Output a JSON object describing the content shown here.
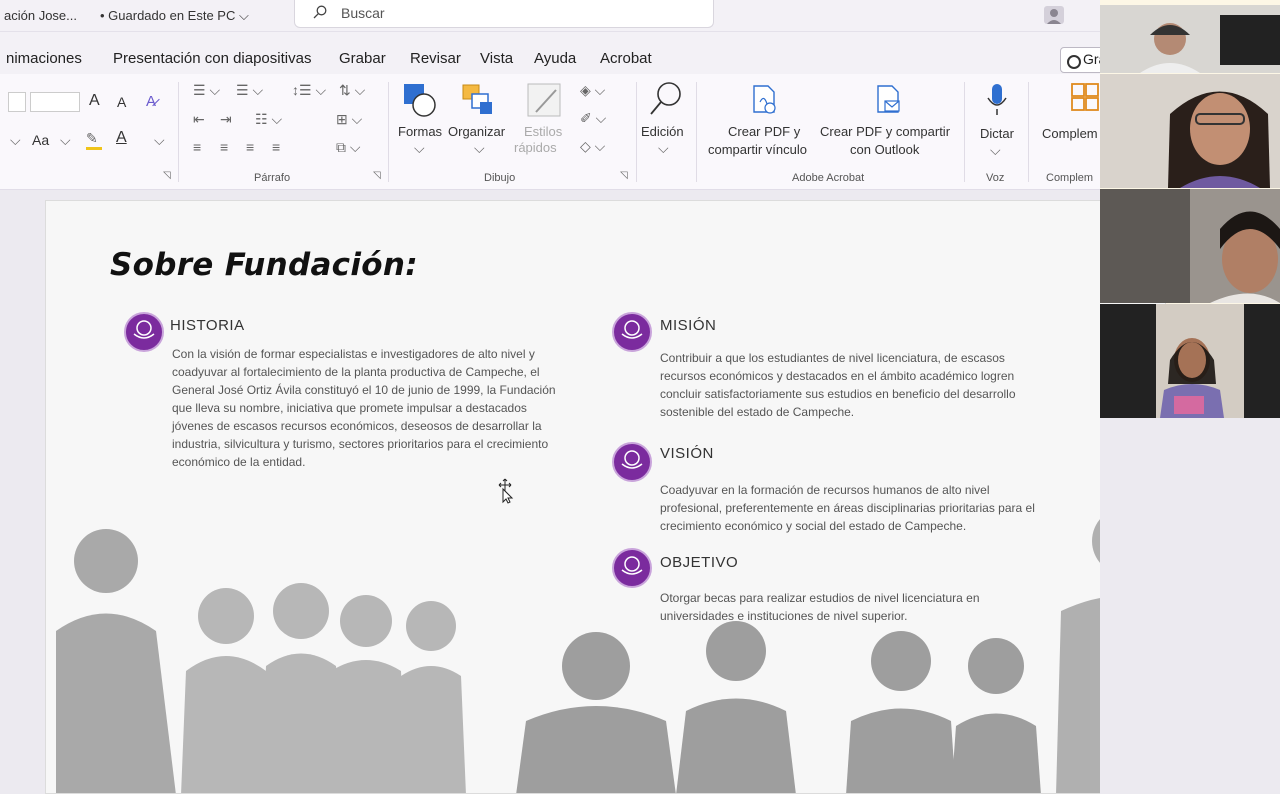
{
  "titlebar": {
    "doc_title": "ación Jose...",
    "saved_status": "• Guardado en Este PC ⌵",
    "search_placeholder": "Buscar"
  },
  "menu": {
    "items": [
      "nimaciones",
      "Presentación con diapositivas",
      "Grabar",
      "Revisar",
      "Vista",
      "Ayuda",
      "Acrobat"
    ],
    "record_button": "Gra"
  },
  "ribbon": {
    "font_grow": "A",
    "font_shrink": "A",
    "case_label": "Aa",
    "paragraph_group": "Párrafo",
    "drawing_group": "Dibujo",
    "shapes": "Formas",
    "arrange": "Organizar",
    "quick_styles_1": "Estilos",
    "quick_styles_2": "rápidos",
    "editing": "Edición",
    "acrobat_group": "Adobe Acrobat",
    "create_pdf_link_1": "Crear PDF y",
    "create_pdf_link_2": "compartir vínculo",
    "create_pdf_outlook_1": "Crear PDF y compartir",
    "create_pdf_outlook_2": "con Outlook",
    "dictate": "Dictar",
    "voice_group": "Voz",
    "addins": "Complem",
    "addins_group": "Complem"
  },
  "slide": {
    "heading": "Sobre Fundación:",
    "sections": {
      "historia": {
        "title": "HISTORIA",
        "lines": [
          "Con la visión de formar especialistas e investigadores de alto nivel y",
          "coadyuvar al fortalecimiento de la planta productiva de Campeche, el",
          "General José Ortiz Ávila constituyó el 10 de junio de 1999, la Fundación",
          "que lleva su nombre, iniciativa que promete impulsar a destacados",
          "jóvenes de escasos recursos económicos, deseosos de desarrollar la",
          "industria, silvicultura y turismo, sectores prioritarios para el crecimiento",
          "económico de la entidad."
        ]
      },
      "mision": {
        "title": "MISIÓN",
        "lines": [
          "Contribuir a que los estudiantes de nivel licenciatura, de escasos",
          "recursos económicos y destacados en el ámbito académico logren",
          "concluir satisfactoriamente sus estudios en beneficio del desarrollo",
          "sostenible del estado de Campeche."
        ]
      },
      "vision": {
        "title": "VISIÓN",
        "lines": [
          "Coadyuvar en la formación de recursos humanos de alto nivel",
          "profesional, preferentemente en áreas disciplinarias prioritarias para el",
          "crecimiento económico y social del estado de Campeche."
        ]
      },
      "objetivo": {
        "title": "OBJETIVO",
        "lines": [
          "Otorgar becas para realizar estudios de nivel licenciatura en",
          "universidades e instituciones de nivel superior."
        ]
      }
    }
  },
  "colors": {
    "accent_purple": "#7b2b9e",
    "ribbon_blue": "#2f6fd0",
    "ribbon_orange": "#e08a1e"
  }
}
